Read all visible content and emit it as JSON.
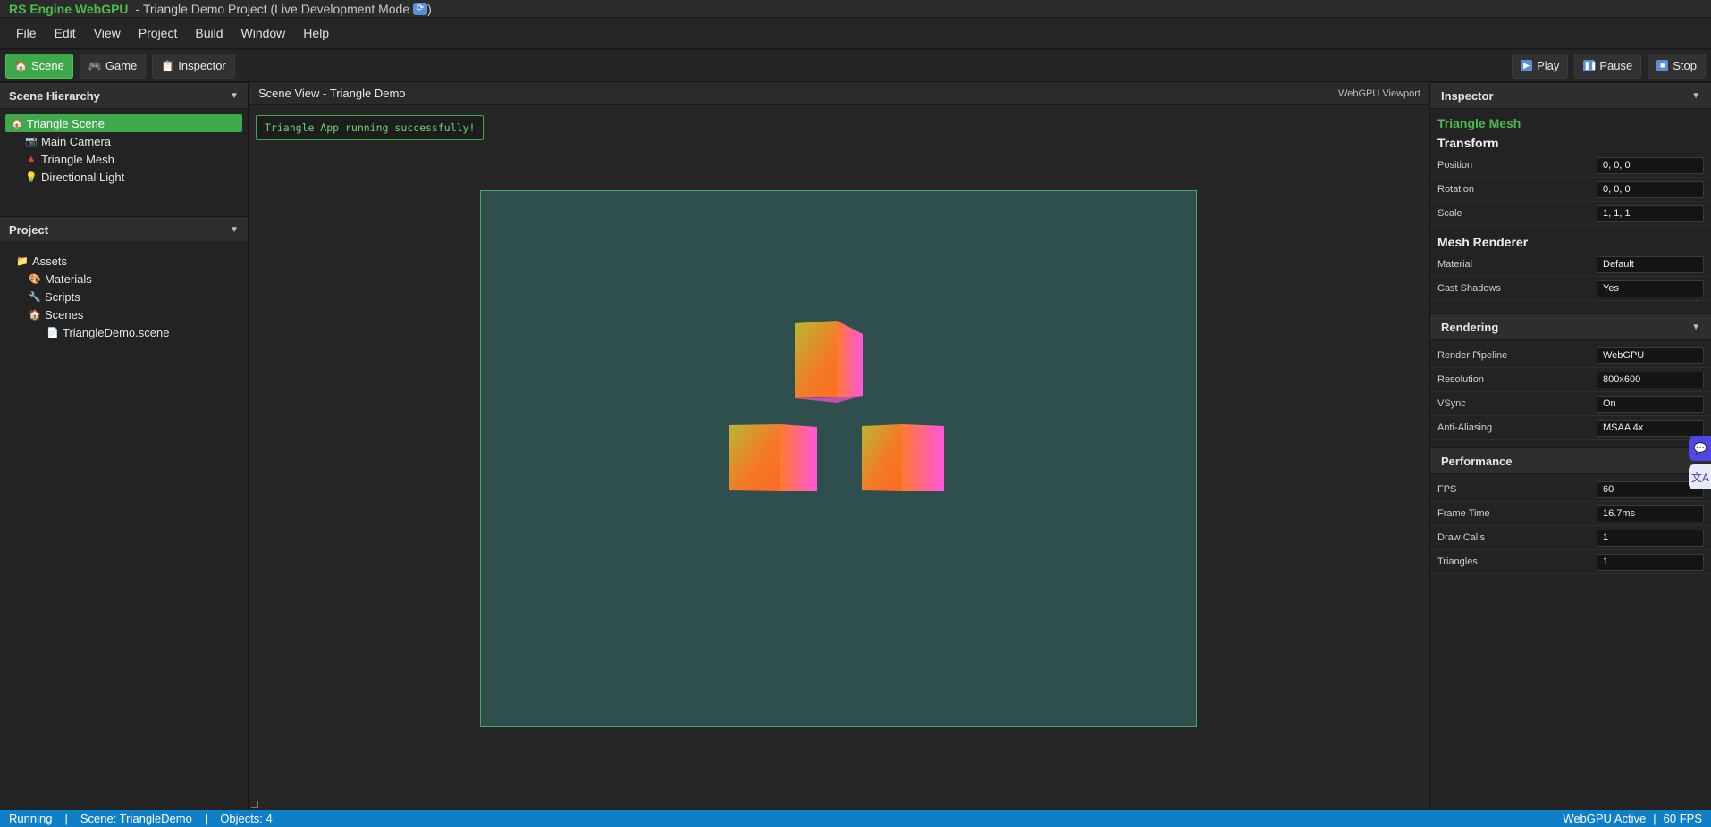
{
  "title": {
    "app": "RS Engine WebGPU",
    "subtitle": "- Triangle Demo Project (Live Development Mode"
  },
  "menu": [
    "File",
    "Edit",
    "View",
    "Project",
    "Build",
    "Window",
    "Help"
  ],
  "toolbar": {
    "scene": "Scene",
    "game": "Game",
    "inspector": "Inspector",
    "play": "Play",
    "pause": "Pause",
    "stop": "Stop"
  },
  "hierarchy": {
    "title": "Scene Hierarchy",
    "items": [
      {
        "label": "Triangle Scene",
        "icon": "house-icon"
      },
      {
        "label": "Main Camera",
        "icon": "camera-icon"
      },
      {
        "label": "Triangle Mesh",
        "icon": "triangle-icon"
      },
      {
        "label": "Directional Light",
        "icon": "bulb-icon"
      }
    ]
  },
  "project": {
    "title": "Project",
    "items": [
      {
        "label": "Assets"
      },
      {
        "label": "Materials"
      },
      {
        "label": "Scripts"
      },
      {
        "label": "Scenes"
      },
      {
        "label": "TriangleDemo.scene"
      }
    ]
  },
  "scene_view": {
    "title": "Scene View - Triangle Demo",
    "viewport_label": "WebGPU Viewport",
    "message": "Triangle App running successfully!"
  },
  "inspector": {
    "title": "Inspector",
    "object": "Triangle Mesh",
    "transform_title": "Transform",
    "transform": [
      {
        "label": "Position",
        "value": "0, 0, 0"
      },
      {
        "label": "Rotation",
        "value": "0, 0, 0"
      },
      {
        "label": "Scale",
        "value": "1, 1, 1"
      }
    ],
    "mesh_title": "Mesh Renderer",
    "mesh": [
      {
        "label": "Material",
        "value": "Default"
      },
      {
        "label": "Cast Shadows",
        "value": "Yes"
      }
    ],
    "rendering_title": "Rendering",
    "rendering": [
      {
        "label": "Render Pipeline",
        "value": "WebGPU"
      },
      {
        "label": "Resolution",
        "value": "800x600"
      },
      {
        "label": "VSync",
        "value": "On"
      },
      {
        "label": "Anti-Aliasing",
        "value": "MSAA 4x"
      }
    ],
    "performance_title": "Performance",
    "performance": [
      {
        "label": "FPS",
        "value": "60"
      },
      {
        "label": "Frame Time",
        "value": "16.7ms"
      },
      {
        "label": "Draw Calls",
        "value": "1"
      },
      {
        "label": "Triangles",
        "value": "1"
      }
    ]
  },
  "statusbar": {
    "state": "Running",
    "scene": "Scene: TriangleDemo",
    "objects": "Objects: 4",
    "gpu": "WebGPU Active",
    "fps": "60 FPS"
  },
  "colors": {
    "accent": "#3ea84a",
    "statusbar": "#0f7fc8",
    "viewport": "#2f4f4f"
  }
}
